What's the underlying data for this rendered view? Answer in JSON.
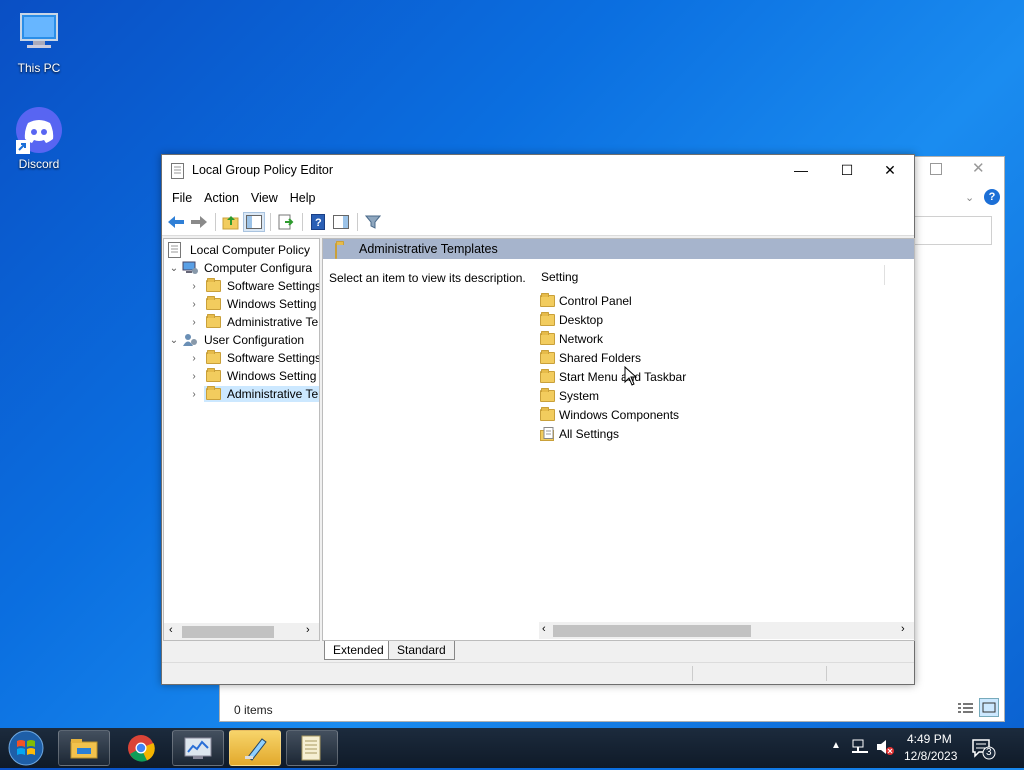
{
  "desktop": {
    "icons": [
      {
        "label": "This PC",
        "icon": "this-pc-icon"
      },
      {
        "label": "Discord",
        "icon": "discord-icon"
      }
    ]
  },
  "background_window": {
    "status": "0 items"
  },
  "window": {
    "title": "Local Group Policy Editor",
    "controls": {
      "minimize": "—",
      "maximize": "☐",
      "close": "✕"
    },
    "menu": [
      "File",
      "Action",
      "View",
      "Help"
    ],
    "tree": {
      "root": "Local Computer Policy",
      "items": [
        {
          "label": "Computer Configura",
          "level": 1,
          "chevron": "expanded"
        },
        {
          "label": "Software Settings",
          "level": 2,
          "chevron": "collapsed"
        },
        {
          "label": "Windows Setting",
          "level": 2,
          "chevron": "collapsed"
        },
        {
          "label": "Administrative Te",
          "level": 2,
          "chevron": "collapsed"
        },
        {
          "label": "User Configuration",
          "level": 1,
          "chevron": "expanded"
        },
        {
          "label": "Software Settings",
          "level": 2,
          "chevron": "collapsed"
        },
        {
          "label": "Windows Setting",
          "level": 2,
          "chevron": "collapsed"
        },
        {
          "label": "Administrative Te",
          "level": 2,
          "chevron": "collapsed",
          "selected": true
        }
      ]
    },
    "right_pane": {
      "header": "Administrative Templates",
      "description": "Select an item to view its description.",
      "column_header": "Setting",
      "items": [
        "Control Panel",
        "Desktop",
        "Network",
        "Shared Folders",
        "Start Menu and Taskbar",
        "System",
        "Windows Components",
        "All Settings"
      ]
    },
    "tabs": [
      "Extended",
      "Standard"
    ]
  },
  "taskbar": {
    "time": "4:49 PM",
    "date": "12/8/2023",
    "notifications": "3"
  }
}
